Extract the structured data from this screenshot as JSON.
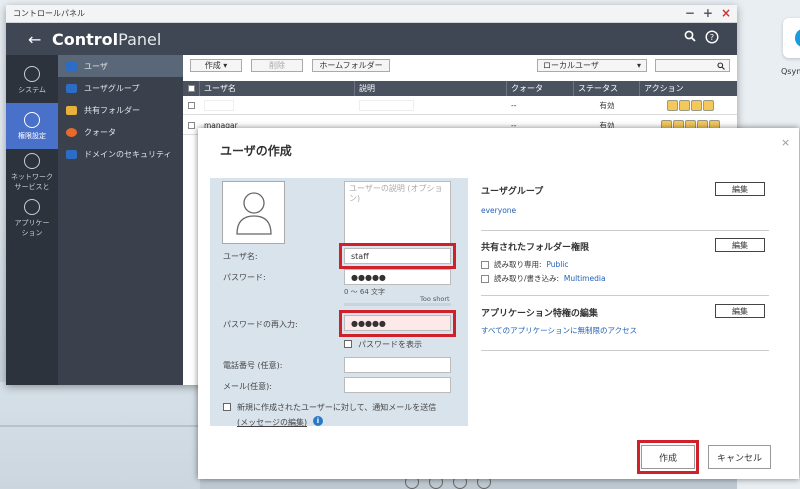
{
  "desktop": {
    "qsync_label": "Qsyn"
  },
  "window": {
    "title": "コントロールパネル",
    "controls": [
      "−",
      "+",
      "×"
    ]
  },
  "header": {
    "back": "←",
    "app_bold": "Control",
    "app_rest": "Panel",
    "search_icon": "search-icon",
    "help_icon": "help-icon"
  },
  "rail": [
    {
      "label": "システム",
      "icon": "gear-icon"
    },
    {
      "label": "権限設定",
      "icon": "user-icon",
      "active": true
    },
    {
      "label": "ネットワーク\nサービスと",
      "icon": "globe-icon"
    },
    {
      "label": "アプリケー\nション",
      "icon": "apps-icon"
    }
  ],
  "subnav": [
    {
      "label": "ユーザ",
      "color": "#2b6cc4",
      "active": true
    },
    {
      "label": "ユーザグループ",
      "color": "#2b6cc4"
    },
    {
      "label": "共有フォルダー",
      "color": "#e8b23a"
    },
    {
      "label": "クォータ",
      "color": "#e86a2b"
    },
    {
      "label": "ドメインのセキュリティ",
      "color": "#2b6cc4"
    }
  ],
  "toolbar": {
    "create": "作成 ▾",
    "delete": "削除",
    "home": "ホームフォルダー",
    "filter": "ローカルユーザ",
    "filter_arrow": "▾",
    "search_icon": "search-icon"
  },
  "table": {
    "headers": [
      "ユーザ名",
      "説明",
      "クォータ",
      "ステータス",
      "アクション"
    ],
    "rows": [
      {
        "name": "",
        "desc": "",
        "quota": "--",
        "status": "有効"
      },
      {
        "name": "managar",
        "desc": "",
        "quota": "--",
        "status": "有効"
      }
    ]
  },
  "dialog": {
    "title": "ユーザの作成",
    "close": "×",
    "description_placeholder": "ユーザーの説明 (オプション)",
    "username_label": "ユーザ名:",
    "username_value": "staff",
    "password_label": "パスワード:",
    "password_value": "●●●●●",
    "password_hint": "0 ～ 64 文字",
    "strength": "Too short",
    "confirm_label": "パスワードの再入力:",
    "confirm_value": "●●●●●",
    "show_password": "パスワードを表示",
    "phone_label": "電話番号 (任意):",
    "email_label": "メール(任意):",
    "notify_label": "新規に作成されたユーザーに対して、通知メールを送信",
    "edit_message": "(メッセージの編集)",
    "info_icon": "i",
    "user_group_title": "ユーザグループ",
    "user_group_value": "everyone",
    "edit": "編集",
    "shared_title": "共有されたフォルダー権限",
    "ro_label": "読み取り専用:",
    "ro_value": "Public",
    "rw_label": "読み取り/書き込み:",
    "rw_value": "Multimedia",
    "app_title": "アプリケーション特権の編集",
    "app_value": "すべてのアプリケーションに無制限のアクセス",
    "create_button": "作成",
    "cancel_button": "キャンセル"
  }
}
